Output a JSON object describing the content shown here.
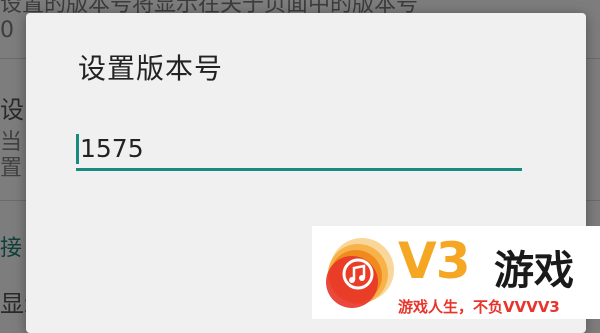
{
  "background": {
    "lines": [
      "设置的版本号将显示在关于页面中的版本号",
      "0",
      "设",
      "当",
      "置",
      "接",
      "显示悬浮按钮"
    ]
  },
  "dialog": {
    "title": "设置版本号",
    "input_value": "1575"
  },
  "watermark": {
    "v3": "V3",
    "brand": "游戏",
    "slogan": "游戏人生，不负VVVV3"
  },
  "colors": {
    "accent": "#1a8a80",
    "watermark_orange": "#f5a623",
    "watermark_red": "#e8342a"
  }
}
